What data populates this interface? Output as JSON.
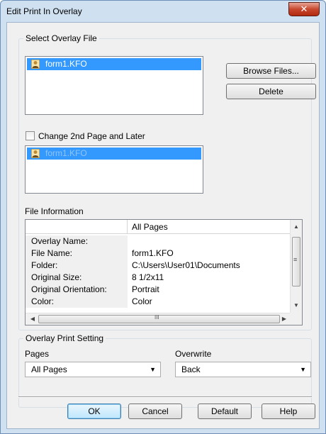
{
  "window": {
    "title": "Edit Print In Overlay",
    "close_glyph": "✕"
  },
  "select_overlay": {
    "legend": "Select Overlay File",
    "selected_file": "form1.KFO",
    "browse_label": "Browse Files...",
    "delete_label": "Delete",
    "change_second_page_label": "Change 2nd Page and Later",
    "change_second_page_checked": false,
    "second_page_file": "form1.KFO"
  },
  "file_info": {
    "label": "File Information",
    "column_header": "All Pages",
    "rows": [
      {
        "label": "Overlay Name:",
        "value": ""
      },
      {
        "label": "File Name:",
        "value": "form1.KFO"
      },
      {
        "label": "Folder:",
        "value": "C:\\Users\\User01\\Documents"
      },
      {
        "label": "Original Size:",
        "value": "8 1/2x11"
      },
      {
        "label": "Original Orientation:",
        "value": "Portrait"
      },
      {
        "label": "Color:",
        "value": "Color"
      }
    ],
    "hscroll_grip": "III",
    "vscroll_grip": "≡"
  },
  "overlay_print": {
    "legend": "Overlay Print Setting",
    "pages_label": "Pages",
    "pages_value": "All Pages",
    "overwrite_label": "Overwrite",
    "overwrite_value": "Back"
  },
  "footer": {
    "ok_label": "OK",
    "cancel_label": "Cancel",
    "default_label": "Default",
    "help_label": "Help"
  },
  "colors": {
    "selection": "#3399ff",
    "frame": "#cfe0f1",
    "close_button": "#c7482e"
  }
}
